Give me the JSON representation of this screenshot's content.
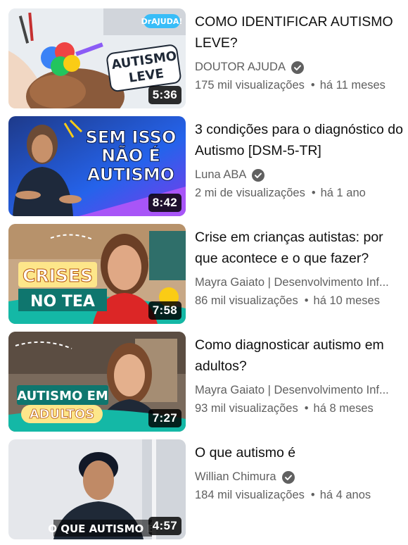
{
  "videos": [
    {
      "title": "COMO IDENTIFICAR AUTISMO LEVE?",
      "channel": "DOUTOR AJUDA",
      "verified": true,
      "views": "175 mil visualizações",
      "age": "há 11 meses",
      "duration": "5:36",
      "thumb_text": [
        "AUTISMO",
        "LEVE"
      ],
      "thumb_logo": "DrAJUDA!"
    },
    {
      "title": "3 condições para o diagnóstico do Autismo [DSM-5-TR]",
      "channel": "Luna ABA",
      "verified": true,
      "views": "2 mi de visualizações",
      "age": "há 1 ano",
      "duration": "8:42",
      "thumb_text": [
        "SEM ISSO",
        "NÃO É",
        "AUTISMO"
      ]
    },
    {
      "title": "Crise em crianças autistas: por que acontece e o que fazer?",
      "channel": "Mayra Gaiato | Desenvolvimento Inf...",
      "verified": false,
      "views": "86 mil visualizações",
      "age": "há 10 meses",
      "duration": "7:58",
      "thumb_text": [
        "CRISES",
        "NO TEA"
      ]
    },
    {
      "title": "Como diagnosticar autismo em adultos?",
      "channel": "Mayra Gaiato | Desenvolvimento Inf...",
      "verified": false,
      "views": "93 mil visualizações",
      "age": "há 8 meses",
      "duration": "7:27",
      "thumb_text": [
        "AUTISMO EM",
        "ADULTOS"
      ]
    },
    {
      "title": "O que autismo é",
      "channel": "Willian Chimura",
      "verified": true,
      "views": "184 mil visualizações",
      "age": "há 4 anos",
      "duration": "4:57",
      "thumb_text": [
        "O QUE AUTISMO É"
      ]
    }
  ],
  "separator": "•",
  "colors": {
    "secondary_text": "#606060",
    "primary_text": "#0f0f0f",
    "badge_bg": "#000000"
  }
}
